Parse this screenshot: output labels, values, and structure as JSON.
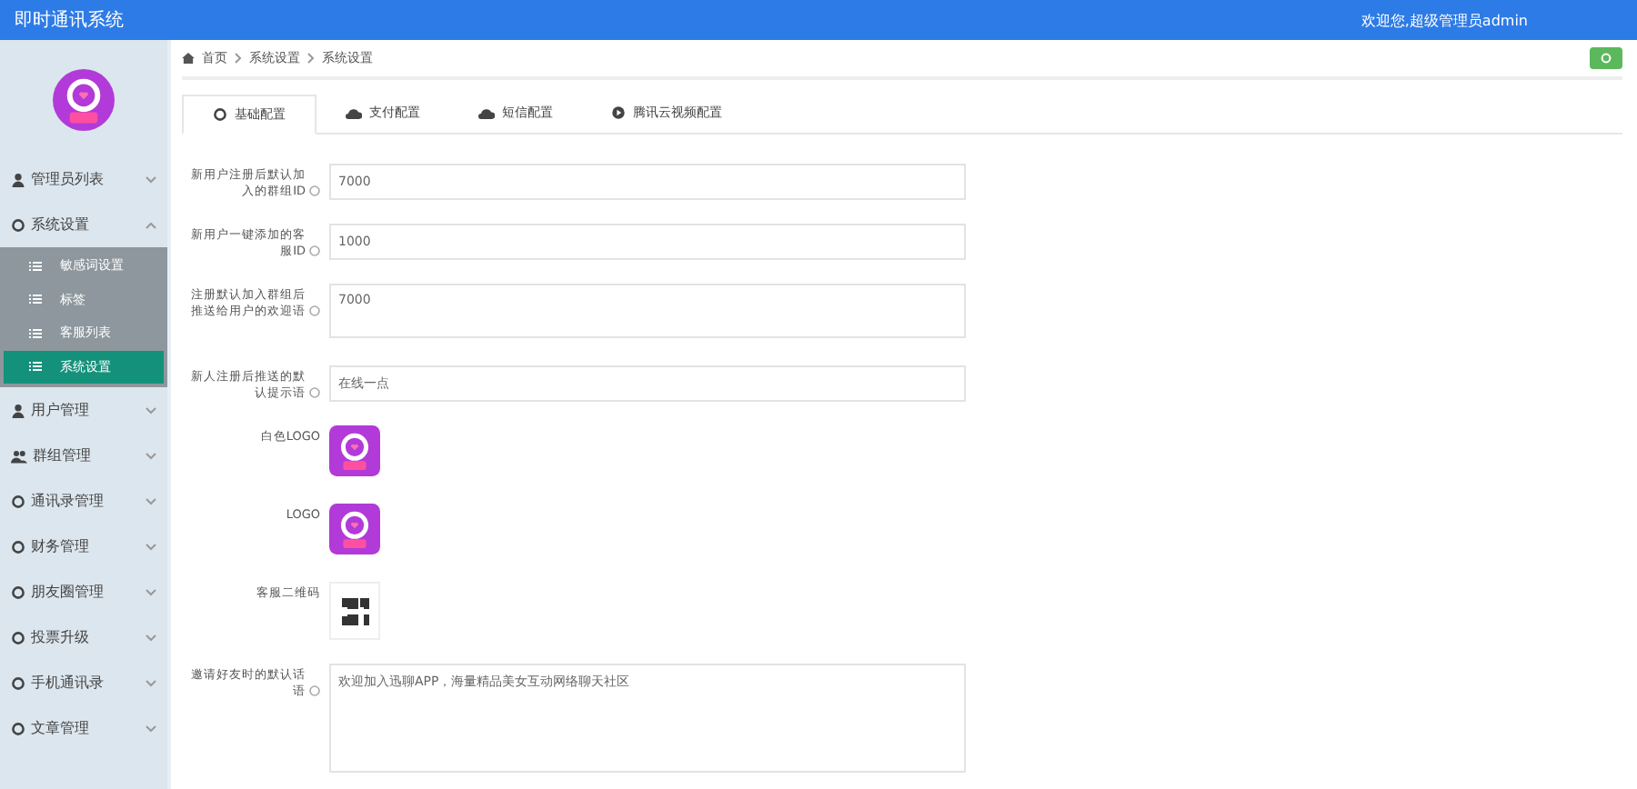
{
  "header": {
    "title": "即时通讯系统",
    "user": "欢迎您,超级管理员admin"
  },
  "sidebar": {
    "items": [
      {
        "label": "管理员列表",
        "expanded": false
      },
      {
        "label": "系统设置",
        "expanded": true,
        "children": [
          {
            "label": "敏感词设置",
            "selected": false
          },
          {
            "label": "标签",
            "selected": false
          },
          {
            "label": "客服列表",
            "selected": false
          },
          {
            "label": "系统设置",
            "selected": true
          }
        ]
      },
      {
        "label": "用户管理",
        "expanded": false
      },
      {
        "label": "群组管理",
        "expanded": false
      },
      {
        "label": "通讯录管理",
        "expanded": false
      },
      {
        "label": "财务管理",
        "expanded": false
      },
      {
        "label": "朋友圈管理",
        "expanded": false
      },
      {
        "label": "投票升级",
        "expanded": false
      },
      {
        "label": "手机通讯录",
        "expanded": false
      },
      {
        "label": "文章管理",
        "expanded": false
      }
    ]
  },
  "breadcrumb": [
    "首页",
    "系统设置",
    "系统设置"
  ],
  "tabs": [
    {
      "label": "基础配置",
      "selected": true
    },
    {
      "label": "支付配置",
      "selected": false
    },
    {
      "label": "短信配置",
      "selected": false
    },
    {
      "label": "腾讯云视频配置",
      "selected": false
    }
  ],
  "form": [
    {
      "kind": "text",
      "label": "新用户注册后默认加入的群组ID",
      "value": "7000"
    },
    {
      "kind": "text",
      "label": "新用户一键添加的客服ID",
      "value": "1000"
    },
    {
      "kind": "textarea",
      "label": "注册默认加入群组后推送给用户的欢迎语",
      "value": "7000"
    },
    {
      "kind": "text",
      "label": "新人注册后推送的默认提示语",
      "value": "在线一点"
    },
    {
      "kind": "logo",
      "label": "白色LOGO"
    },
    {
      "kind": "logo",
      "label": "LOGO"
    },
    {
      "kind": "qr",
      "label": "客服二维码"
    },
    {
      "kind": "textarea",
      "label": "邀请好友时的默认话语",
      "value": "欢迎加入迅聊APP，海量精品美女互动网络聊天社区"
    }
  ]
}
